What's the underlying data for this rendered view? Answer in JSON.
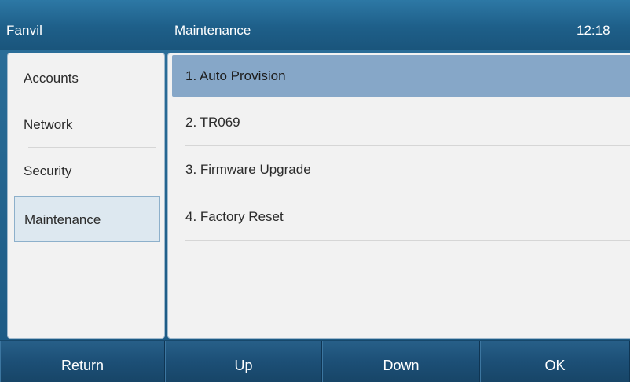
{
  "titlebar": {
    "brand": "Fanvil",
    "page_title": "Maintenance",
    "clock": "12:18"
  },
  "sidebar": {
    "items": [
      {
        "label": "Accounts"
      },
      {
        "label": "Network"
      },
      {
        "label": "Security"
      },
      {
        "label": "Maintenance"
      }
    ],
    "selected": "Maintenance"
  },
  "menu": {
    "items": [
      {
        "label": "1.  Auto Provision"
      },
      {
        "label": "2.  TR069"
      },
      {
        "label": "3.  Firmware Upgrade"
      },
      {
        "label": "4.  Factory Reset"
      }
    ],
    "selected": "1.  Auto Provision"
  },
  "softkeys": {
    "return_label": "Return",
    "up_label": "Up",
    "down_label": "Down",
    "ok_label": "OK"
  },
  "colors": {
    "titlebar": "#1e5f89",
    "selection_highlight": "#86a7c8",
    "panel_background": "#f2f2f2",
    "softkey_bar": "#1c4f76"
  }
}
